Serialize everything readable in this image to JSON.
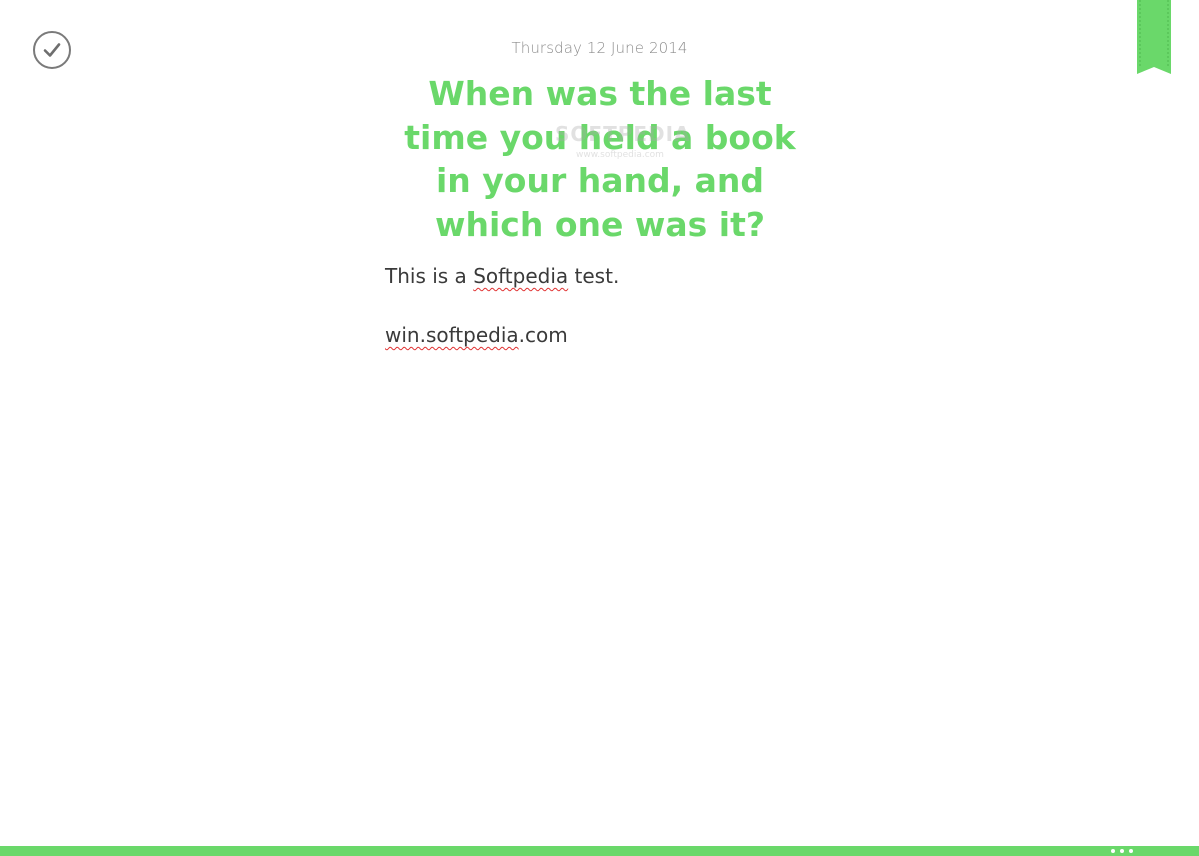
{
  "entry": {
    "date": "Thursday 12 June 2014",
    "prompt": "When was the last time you held a book in your hand, and which one was it?",
    "body_line1": {
      "prefix": "This is a ",
      "misspelled": "Softpedia",
      "suffix": " test."
    },
    "body_line2": {
      "misspelled": "win.softpedia",
      "suffix": ".com"
    }
  },
  "icons": {
    "done": "checkmark-circle-icon",
    "bookmark": "bookmark-ribbon-icon",
    "more": "ellipsis-icon"
  },
  "watermark": {
    "logo": "SOFTPEDIA",
    "url": "www.softpedia.com"
  },
  "colors": {
    "accent": "#6ad86a",
    "spellcheck": "#e03030",
    "text": "#3a3a3a",
    "muted": "#8c8c8c"
  }
}
